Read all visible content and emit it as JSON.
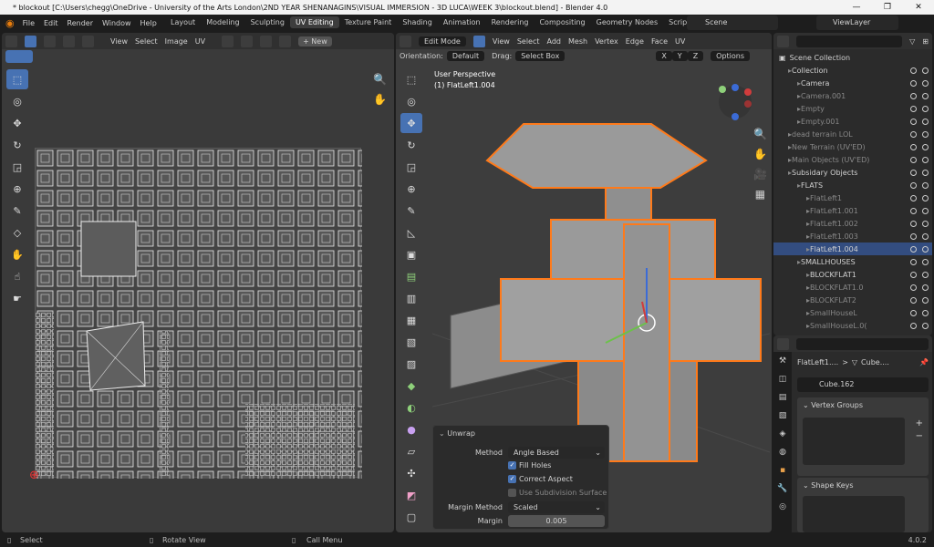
{
  "window": {
    "title": "* blockout [C:\\Users\\chegg\\OneDrive - University of the Arts London\\2ND YEAR SHENANAGINS\\VISUAL IMMERSION - 3D LUCA\\WEEK 3\\blockout.blend] - Blender 4.0",
    "controls": [
      "—",
      "❐",
      "✕"
    ]
  },
  "menu": [
    "File",
    "Edit",
    "Render",
    "Window",
    "Help"
  ],
  "workspaces": [
    "Layout",
    "Modeling",
    "Sculpting",
    "UV Editing",
    "Texture Paint",
    "Shading",
    "Animation",
    "Rendering",
    "Compositing",
    "Geometry Nodes",
    "Scriptin"
  ],
  "scene": "Scene",
  "view_layer": "ViewLayer",
  "uv_editor": {
    "menus": [
      "View",
      "Select",
      "Image",
      "UV"
    ],
    "new_label": "+ New"
  },
  "viewport": {
    "mode": "Edit Mode",
    "menus": [
      "View",
      "Select",
      "Add",
      "Mesh",
      "Vertex",
      "Edge",
      "Face",
      "UV"
    ],
    "orientation_label": "Orientation:",
    "orientation_value": "Default",
    "drag_label": "Drag:",
    "drag_value": "Select Box",
    "axes": [
      "X",
      "Y",
      "Z"
    ],
    "options_label": "Options",
    "overlay_line1": "User Perspective",
    "overlay_line2": "(1) FlatLeft1.004"
  },
  "unwrap": {
    "title": "Unwrap",
    "method_label": "Method",
    "method_value": "Angle Based",
    "fill_holes": "Fill Holes",
    "correct_aspect": "Correct Aspect",
    "use_subdiv": "Use Subdivision Surface",
    "margin_method_label": "Margin Method",
    "margin_method_value": "Scaled",
    "margin_label": "Margin",
    "margin_value": "0.005"
  },
  "outliner": {
    "root": "Scene Collection",
    "rows": [
      {
        "label": "Collection",
        "indent": 1,
        "dim": false
      },
      {
        "label": "Camera",
        "indent": 2,
        "dim": false
      },
      {
        "label": "Camera.001",
        "indent": 2,
        "dim": true
      },
      {
        "label": "Empty",
        "indent": 2,
        "dim": true
      },
      {
        "label": "Empty.001",
        "indent": 2,
        "dim": true
      },
      {
        "label": "dead terrain LOL",
        "indent": 1,
        "dim": true
      },
      {
        "label": "New Terrain (UV'ED)",
        "indent": 1,
        "dim": true
      },
      {
        "label": "Main Objects (UV'ED)",
        "indent": 1,
        "dim": true
      },
      {
        "label": "Subsidary Objects",
        "indent": 1,
        "dim": false
      },
      {
        "label": "FLATS",
        "indent": 2,
        "dim": false
      },
      {
        "label": "FlatLeft1",
        "indent": 3,
        "dim": true
      },
      {
        "label": "FlatLeft1.001",
        "indent": 3,
        "dim": true
      },
      {
        "label": "FlatLeft1.002",
        "indent": 3,
        "dim": true
      },
      {
        "label": "FlatLeft1.003",
        "indent": 3,
        "dim": true
      },
      {
        "label": "FlatLeft1.004",
        "indent": 3,
        "dim": false,
        "selected": true
      },
      {
        "label": "SMALLHOUSES",
        "indent": 2,
        "dim": false
      },
      {
        "label": "BLOCKFLAT1",
        "indent": 3,
        "dim": false
      },
      {
        "label": "BLOCKFLAT1.0",
        "indent": 3,
        "dim": true
      },
      {
        "label": "BLOCKFLAT2",
        "indent": 3,
        "dim": true
      },
      {
        "label": "SmallHouseL",
        "indent": 3,
        "dim": true
      },
      {
        "label": "SmallHouseL.0(",
        "indent": 3,
        "dim": true
      }
    ]
  },
  "properties": {
    "breadcrumb_object": "FlatLeft1....",
    "breadcrumb_sep": ">",
    "breadcrumb_data": "Cube....",
    "mesh_name": "Cube.162",
    "vertex_groups": "Vertex Groups",
    "shape_keys": "Shape Keys"
  },
  "status": {
    "select": "Select",
    "rotate": "Rotate View",
    "call_menu": "Call Menu",
    "version": "4.0.2"
  },
  "colors": {
    "accent": "#4772b3",
    "selection_orange": "#ff7a1a",
    "panel_bg": "#2b2b2b"
  }
}
